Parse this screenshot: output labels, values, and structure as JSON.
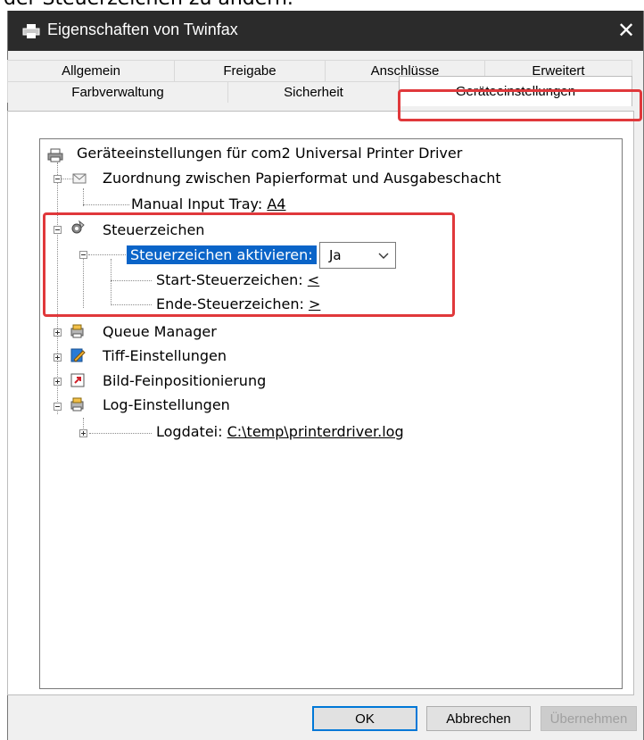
{
  "caption": "der Steuerzeichen zu ändern.",
  "window": {
    "title": "Eigenschaften von Twinfax",
    "close_glyph": "✕"
  },
  "tabs": {
    "row1": [
      "Allgemein",
      "Freigabe",
      "Anschlüsse",
      "Erweitert"
    ],
    "row2": [
      "Farbverwaltung",
      "Sicherheit",
      "Geräteeinstellungen"
    ],
    "active": "Geräteeinstellungen"
  },
  "tree": {
    "root": "Geräteeinstellungen für com2 Universal Printer Driver",
    "paper_mapping": "Zuordnung zwischen Papierformat und Ausgabeschacht",
    "manual_tray_label": "Manual Input Tray:",
    "manual_tray_value": "A4",
    "control_chars": "Steuerzeichen",
    "activate_label": "Steuerzeichen aktivieren:",
    "activate_value": "Ja",
    "start_label": "Start-Steuerzeichen:",
    "start_value": "<",
    "end_label": "Ende-Steuerzeichen:",
    "end_value": ">",
    "queue_manager": "Queue Manager",
    "tiff": "Tiff-Einstellungen",
    "image_pos": "Bild-Feinpositionierung",
    "log": "Log-Einstellungen",
    "logfile_label": "Logdatei:",
    "logfile_value": "C:\\temp\\printerdriver.log"
  },
  "buttons": {
    "ok": "OK",
    "cancel": "Abbrechen",
    "apply": "Übernehmen"
  },
  "colors": {
    "highlight": "#e0383b",
    "selection": "#0a64c8",
    "titlebar": "#2b2b2b"
  }
}
